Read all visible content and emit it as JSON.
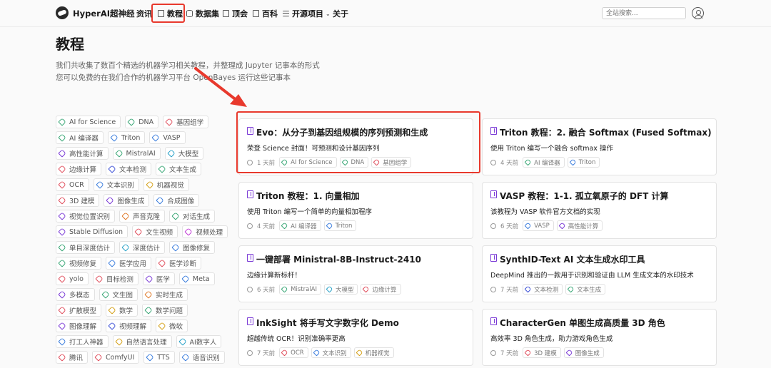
{
  "nav": {
    "brand": "HyperAI超神经",
    "items": [
      {
        "label": "资讯",
        "icon": "news-icon"
      },
      {
        "label": "教程",
        "icon": "tutorial-icon"
      },
      {
        "label": "数据集",
        "icon": "dataset-icon"
      },
      {
        "label": "顶会",
        "icon": "conference-icon"
      },
      {
        "label": "百科",
        "icon": "wiki-icon"
      },
      {
        "label": "开源项目",
        "icon": "menu-icon"
      },
      {
        "label": "关于",
        "icon": ""
      }
    ],
    "search_placeholder": "全站搜索..."
  },
  "header": {
    "title": "教程",
    "desc_line1": "我们共收集了数百个精选的机器学习相关教程，并整理成 Jupyter 记事本的形式",
    "desc_line2": "您可以免费的在我们合作的机器学习平台 OpenBayes 运行这些记事本"
  },
  "tags": [
    {
      "label": "AI for Science",
      "color": "#3aa776"
    },
    {
      "label": "DNA",
      "color": "#3aa776"
    },
    {
      "label": "基因组学",
      "color": "#e04e5c"
    },
    {
      "label": "AI 编译器",
      "color": "#3aa776"
    },
    {
      "label": "Triton",
      "color": "#3b7ddd"
    },
    {
      "label": "VASP",
      "color": "#3b7ddd"
    },
    {
      "label": "高性能计算",
      "color": "#7b3bd6"
    },
    {
      "label": "MistralAI",
      "color": "#3aa776"
    },
    {
      "label": "大模型",
      "color": "#2aa2c8"
    },
    {
      "label": "边缘计算",
      "color": "#e04e5c"
    },
    {
      "label": "文本检测",
      "color": "#3b4fd6"
    },
    {
      "label": "文本生成",
      "color": "#3aa776"
    },
    {
      "label": "OCR",
      "color": "#e04e5c"
    },
    {
      "label": "文本识别",
      "color": "#3b7ddd"
    },
    {
      "label": "机器视觉",
      "color": "#d4a017"
    },
    {
      "label": "3D 建模",
      "color": "#e04e5c"
    },
    {
      "label": "图像生成",
      "color": "#7b3bd6"
    },
    {
      "label": "合成图像",
      "color": "#3b7ddd"
    },
    {
      "label": "视觉位置识别",
      "color": "#7b3bd6"
    },
    {
      "label": "声音克隆",
      "color": "#e07a2a"
    },
    {
      "label": "对话生成",
      "color": "#3aa776"
    },
    {
      "label": "Stable Diffusion",
      "color": "#7b3bd6"
    },
    {
      "label": "文生视频",
      "color": "#e04e5c"
    },
    {
      "label": "视频处理",
      "color": "#c23bd6"
    },
    {
      "label": "单目深度估计",
      "color": "#3aa776"
    },
    {
      "label": "深度估计",
      "color": "#2aa2c8"
    },
    {
      "label": "图像修复",
      "color": "#3b7ddd"
    },
    {
      "label": "视频修复",
      "color": "#3aa776"
    },
    {
      "label": "医学应用",
      "color": "#3b7ddd"
    },
    {
      "label": "医学诊断",
      "color": "#e04e5c"
    },
    {
      "label": "yolo",
      "color": "#e04e5c"
    },
    {
      "label": "目标检测",
      "color": "#e04e5c"
    },
    {
      "label": "医学",
      "color": "#7b3bd6"
    },
    {
      "label": "Meta",
      "color": "#3b7ddd"
    },
    {
      "label": "多模态",
      "color": "#7b3bd6"
    },
    {
      "label": "文生图",
      "color": "#3aa776"
    },
    {
      "label": "实时生成",
      "color": "#e07a2a"
    },
    {
      "label": "扩散模型",
      "color": "#e04e5c"
    },
    {
      "label": "数学",
      "color": "#d4a017"
    },
    {
      "label": "数学问题",
      "color": "#3aa776"
    },
    {
      "label": "图像理解",
      "color": "#7b3bd6"
    },
    {
      "label": "视频理解",
      "color": "#3b4fd6"
    },
    {
      "label": "微软",
      "color": "#d4a017"
    },
    {
      "label": "打工人神器",
      "color": "#3b7ddd"
    },
    {
      "label": "自然语言处理",
      "color": "#d4a017"
    },
    {
      "label": "AI数字人",
      "color": "#2aa2c8"
    },
    {
      "label": "腾讯",
      "color": "#e04e5c"
    },
    {
      "label": "ComfyUI",
      "color": "#e04e5c"
    },
    {
      "label": "TTS",
      "color": "#3b7ddd"
    },
    {
      "label": "语音识别",
      "color": "#3b7ddd"
    }
  ],
  "cards": [
    {
      "title": "Evo：从分子到基因组规模的序列预测和生成",
      "subtitle": "荣登 Science 封面！可预测和设计基因序列",
      "time": "1 天前",
      "tags": [
        {
          "label": "AI for Science",
          "color": "#3aa776"
        },
        {
          "label": "DNA",
          "color": "#3aa776"
        },
        {
          "label": "基因组学",
          "color": "#e04e5c"
        }
      ]
    },
    {
      "title": "Triton 教程：2. 融合 Softmax (Fused Softmax)",
      "subtitle": "使用 Triton 编写一个融合 softmax 操作",
      "time": "4 天前",
      "tags": [
        {
          "label": "AI 编译器",
          "color": "#3aa776"
        },
        {
          "label": "Triton",
          "color": "#3b7ddd"
        }
      ]
    },
    {
      "title": "Triton 教程：1. 向量相加",
      "subtitle": "使用 Triton 编写一个简单的向量相加程序",
      "time": "4 天前",
      "tags": [
        {
          "label": "AI 编译器",
          "color": "#3aa776"
        },
        {
          "label": "Triton",
          "color": "#3b7ddd"
        }
      ]
    },
    {
      "title": "VASP 教程：1-1. 孤立氧原子的 DFT 计算",
      "subtitle": "该教程为 VASP 软件官方文档的实现",
      "time": "6 天前",
      "tags": [
        {
          "label": "VASP",
          "color": "#3b7ddd"
        },
        {
          "label": "高性能计算",
          "color": "#7b3bd6"
        }
      ]
    },
    {
      "title": "一键部署 Ministral-8B-Instruct-2410",
      "subtitle": "边缘计算新标杆！",
      "time": "6 天前",
      "tags": [
        {
          "label": "MistralAI",
          "color": "#3aa776"
        },
        {
          "label": "大模型",
          "color": "#2aa2c8"
        },
        {
          "label": "边缘计算",
          "color": "#e04e5c"
        }
      ]
    },
    {
      "title": "SynthID-Text AI 文本生成水印工具",
      "subtitle": "DeepMind 推出的一款用于识别和验证由 LLM 生成文本的水印技术",
      "time": "7 天前",
      "tags": [
        {
          "label": "文本检测",
          "color": "#3b4fd6"
        },
        {
          "label": "文本生成",
          "color": "#3aa776"
        }
      ]
    },
    {
      "title": "InkSight 将手写文字数字化 Demo",
      "subtitle": "超越传统 OCR！识别准确率更高",
      "time": "7 天前",
      "tags": [
        {
          "label": "OCR",
          "color": "#e04e5c"
        },
        {
          "label": "文本识别",
          "color": "#3b7ddd"
        },
        {
          "label": "机器视觉",
          "color": "#d4a017"
        }
      ]
    },
    {
      "title": "CharacterGen 单图生成高质量 3D 角色",
      "subtitle": "高效率 3D 角色生成，助力游戏角色生成",
      "time": "7 天前",
      "tags": [
        {
          "label": "3D 建模",
          "color": "#e04e5c"
        },
        {
          "label": "图像生成",
          "color": "#7b3bd6"
        }
      ]
    }
  ]
}
